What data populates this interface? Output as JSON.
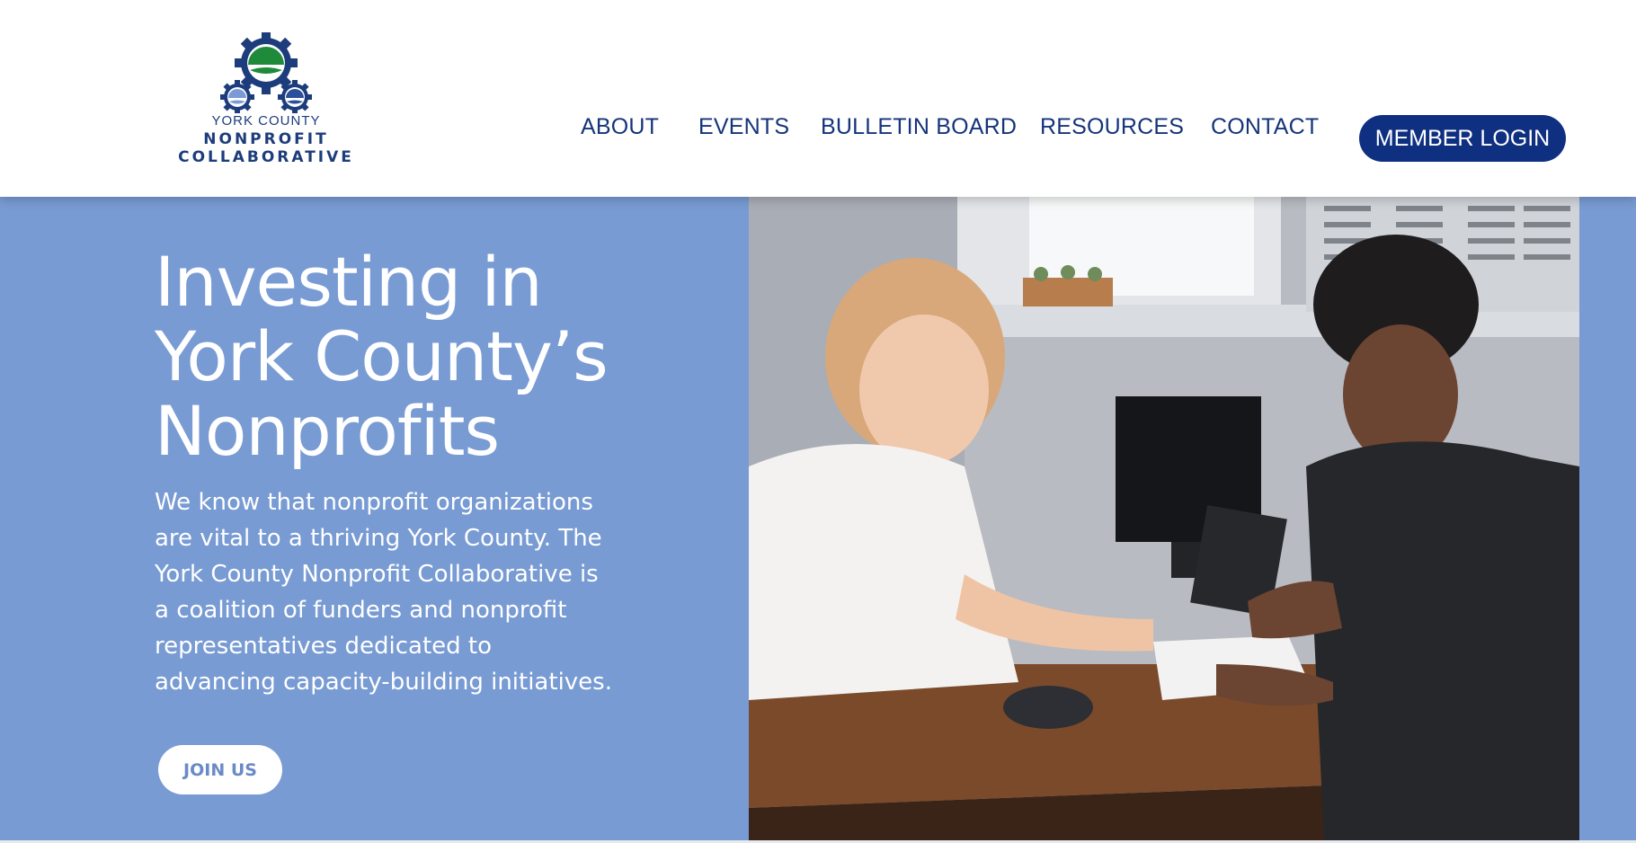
{
  "logo": {
    "line1": "YORK COUNTY",
    "line2": "NONPROFIT",
    "line3": "COLLABORATIVE"
  },
  "nav": {
    "items": [
      {
        "label": "ABOUT"
      },
      {
        "label": "EVENTS"
      },
      {
        "label": "BULLETIN BOARD"
      },
      {
        "label": "RESOURCES"
      },
      {
        "label": "CONTACT"
      }
    ],
    "login_label": "MEMBER LOGIN"
  },
  "hero": {
    "title_line1": "Investing in",
    "title_line2": "York County’s",
    "title_line3": "Nonprofits",
    "desc_line1": "We know that nonprofit organizations",
    "desc_line2": "are vital to a thriving York County. The",
    "desc_line3": "York County Nonprofit Collaborative is",
    "desc_line4": "a coalition of funders and nonprofit",
    "desc_line5": "representatives dedicated to",
    "desc_line6": "advancing capacity-building initiatives.",
    "cta_label": "JOIN US"
  },
  "colors": {
    "brand_navy": "#0f2f80",
    "hero_blue": "#789bd3",
    "logo_green": "#1e8a3a"
  },
  "icons": {
    "logo": "gears-logo-icon",
    "photo": "hero-photo"
  }
}
